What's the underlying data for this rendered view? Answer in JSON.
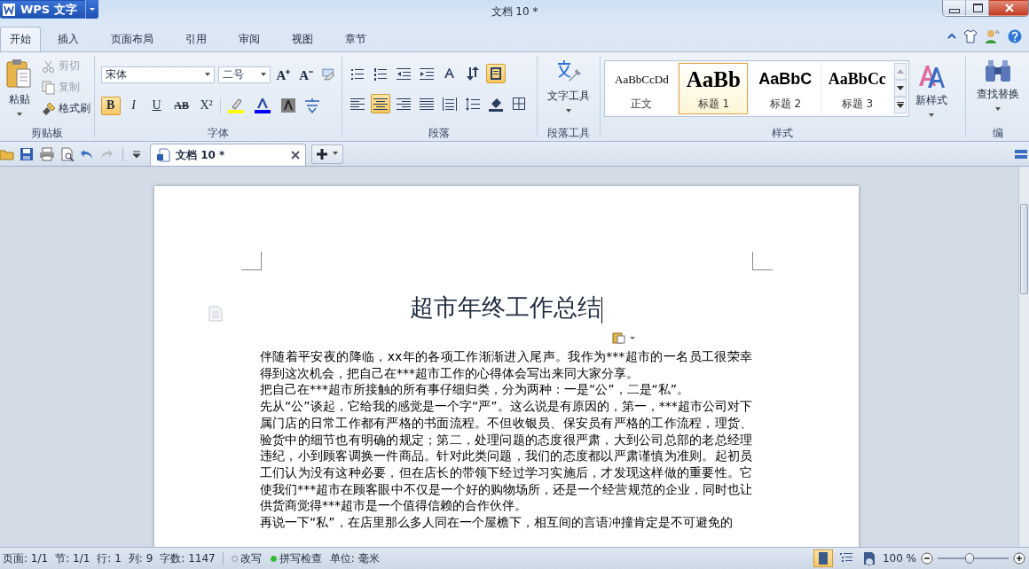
{
  "window": {
    "app_button": "WPS 文字",
    "title": "文档 10 *"
  },
  "menu_tabs": [
    {
      "label": "开始",
      "selected": true
    },
    {
      "label": "插入",
      "selected": false
    },
    {
      "label": "页面布局",
      "selected": false
    },
    {
      "label": "引用",
      "selected": false
    },
    {
      "label": "审阅",
      "selected": false
    },
    {
      "label": "视图",
      "selected": false
    },
    {
      "label": "章节",
      "selected": false
    }
  ],
  "ribbon": {
    "clipboard": {
      "label": "剪贴板",
      "paste": "粘贴",
      "items": [
        {
          "kind": "cut",
          "label": "剪切",
          "disabled": true
        },
        {
          "kind": "copy",
          "label": "复制",
          "disabled": true
        },
        {
          "kind": "painter",
          "label": "格式刷",
          "disabled": false
        }
      ]
    },
    "font": {
      "label": "字体",
      "font_name": "宋体",
      "font_size": "二号",
      "size_buttons": [
        "A⁺",
        "A⁻"
      ],
      "format_buttons": [
        {
          "label": "B",
          "kind": "bold",
          "selected": true
        },
        {
          "label": "I",
          "kind": "italic",
          "selected": false
        },
        {
          "label": "U",
          "kind": "underline",
          "selected": false
        },
        {
          "label": "AB",
          "kind": "strike",
          "selected": false
        },
        {
          "label": "X²",
          "kind": "super",
          "selected": false
        }
      ],
      "color_buttons": [
        {
          "kind": "highlight",
          "color": "#ffff00"
        },
        {
          "kind": "font-color",
          "color": "#0000ff"
        },
        {
          "kind": "shading",
          "color": "#808080"
        }
      ]
    },
    "paragraph": {
      "label": "段落",
      "row1": [
        {
          "kind": "bullets",
          "selected": false
        },
        {
          "kind": "numbering",
          "selected": false
        },
        {
          "kind": "outdent",
          "selected": false
        },
        {
          "kind": "indent",
          "selected": false
        },
        {
          "kind": "spacing",
          "selected": false
        },
        {
          "kind": "direction",
          "selected": false
        },
        {
          "kind": "frame",
          "selected": true
        }
      ],
      "row2": [
        {
          "kind": "align-left",
          "selected": false
        },
        {
          "kind": "align-center",
          "selected": true
        },
        {
          "kind": "align-right",
          "selected": false
        },
        {
          "kind": "justify",
          "selected": false
        },
        {
          "kind": "distribute",
          "selected": false
        },
        {
          "kind": "line-spacing",
          "selected": false
        },
        {
          "kind": "fill",
          "selected": false
        },
        {
          "kind": "border",
          "selected": false
        }
      ]
    },
    "para_tools": {
      "label": "段落工具",
      "button": "文字工具"
    },
    "styles": {
      "label": "样式",
      "items": [
        {
          "kind": "body",
          "preview": "AaBbCcDd",
          "name": "正文",
          "selected": false
        },
        {
          "kind": "h1",
          "preview": "AaBb",
          "name": "标题 1",
          "selected": true
        },
        {
          "kind": "h2",
          "preview": "AaBbC",
          "name": "标题 2",
          "selected": false
        },
        {
          "kind": "h3",
          "preview": "AaBbCc",
          "name": "标题 3",
          "selected": false
        }
      ],
      "new_style": "新样式"
    },
    "edit": {
      "label": "编",
      "button": "查找替换"
    }
  },
  "doc_tab": {
    "label": "文档 10 *"
  },
  "document": {
    "title": "超市年终工作总结",
    "paragraphs": [
      "伴随着平安夜的降临，xx年的各项工作渐渐进入尾声。我作为***超市的一名员工很荣幸得到这次机会，把自己在***超市工作的心得体会写出来同大家分享。",
      "把自己在***超市所接触的所有事仔细归类，分为两种：一是“公”，二是“私”。",
      "先从“公”谈起，它给我的感觉是一个字“严”。这么说是有原因的，第一，***超市公司对下属门店的日常工作都有严格的书面流程。不但收银员、保安员有严格的工作流程，理货、验货中的细节也有明确的规定；第二，处理问题的态度很严肃，大到公司总部的老总经理违纪，小到顾客调换一件商品。针对此类问题，我们的态度都以严肃谨慎为准则。起初员工们认为没有这种必要，但在店长的带领下经过学习实施后，才发现这样做的重要性。它使我们***超市在顾客眼中不仅是一个好的购物场所，还是一个经营规范的企业，同时也让供货商觉得***超市是一个值得信赖的合作伙伴。",
      "再说一下“私”，在店里那么多人同在一个屋檐下，相互间的言语冲撞肯定是不可避免的"
    ]
  },
  "status_bar": {
    "items": [
      "页面: 1/1",
      "节: 1/1",
      "行: 1",
      "列: 9",
      "字数: 1147"
    ],
    "toggles": [
      {
        "label": "改写",
        "on": false
      },
      {
        "label": "拼写检查",
        "on": true
      }
    ],
    "unit": "单位: 毫米",
    "views": [
      {
        "kind": "page",
        "selected": true
      },
      {
        "kind": "outline",
        "selected": false
      },
      {
        "kind": "web",
        "selected": false
      }
    ],
    "zoom": "100 %",
    "zoom_level": {
      "level": 0.45
    }
  }
}
